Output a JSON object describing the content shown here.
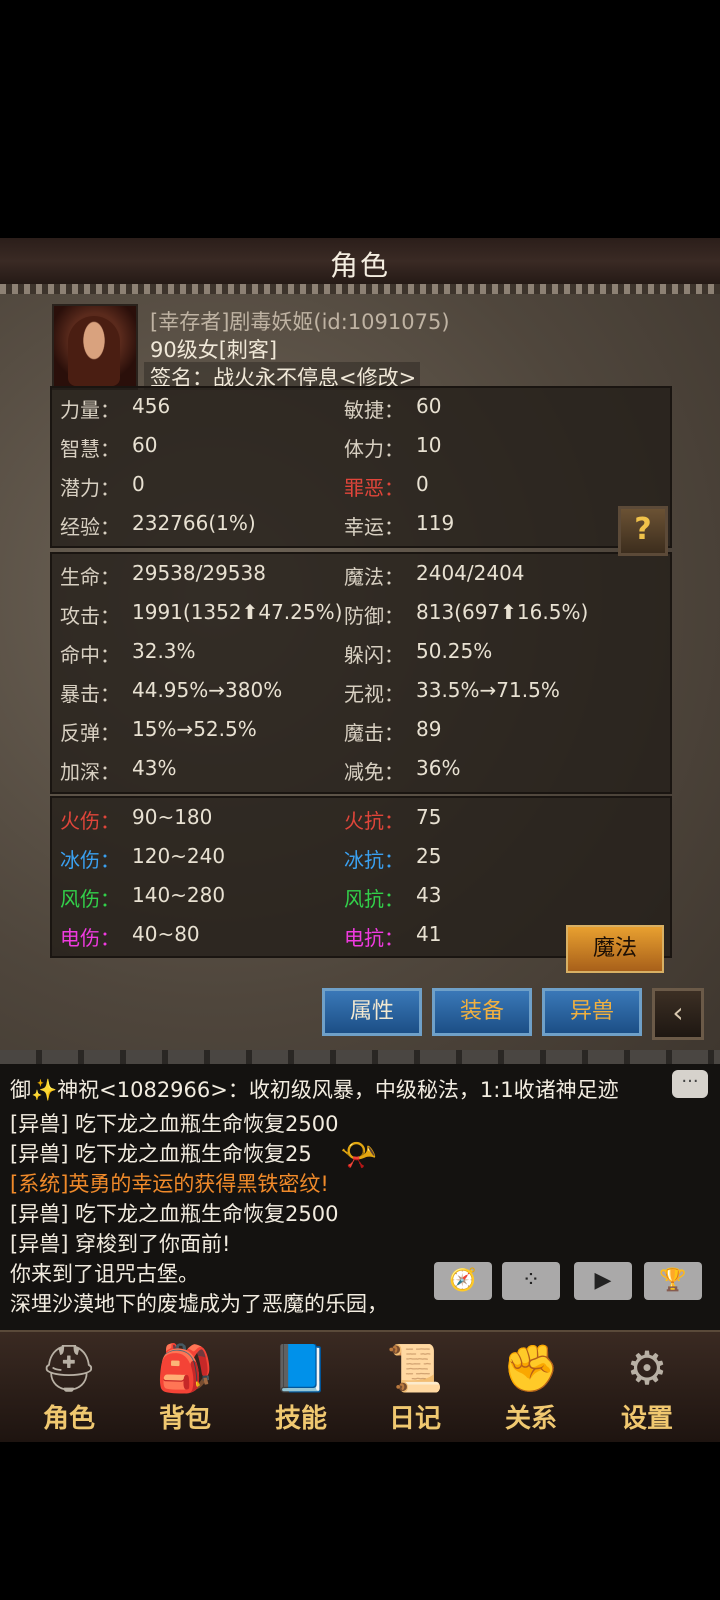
{
  "title": "角色",
  "character": {
    "name": "[幸存者]剧毒妖姬(id:1091075)",
    "level_class": "90级女[刺客]",
    "signature": "签名：战火永不停息<修改>"
  },
  "basic_stats": [
    {
      "label": "力量：",
      "value": "456"
    },
    {
      "label": "敏捷：",
      "value": "60"
    },
    {
      "label": "智慧：",
      "value": "60"
    },
    {
      "label": "体力：",
      "value": "10"
    },
    {
      "label": "潜力：",
      "value": "0"
    },
    {
      "label": "罪恶：",
      "value": "0",
      "color": "#e0453a"
    },
    {
      "label": "经验：",
      "value": "232766(1%)"
    },
    {
      "label": "幸运：",
      "value": "119"
    }
  ],
  "combat_stats": [
    {
      "label": "生命：",
      "value": "29538/29538"
    },
    {
      "label": "魔法：",
      "value": "2404/2404"
    },
    {
      "label": "攻击：",
      "value": "1991(1352⬆47.25%)"
    },
    {
      "label": "防御：",
      "value": "813(697⬆16.5%)"
    },
    {
      "label": "命中：",
      "value": "32.3%"
    },
    {
      "label": "躲闪：",
      "value": "50.25%"
    },
    {
      "label": "暴击：",
      "value": "44.95%→380%"
    },
    {
      "label": "无视：",
      "value": "33.5%→71.5%"
    },
    {
      "label": "反弹：",
      "value": "15%→52.5%"
    },
    {
      "label": "魔击：",
      "value": "89"
    },
    {
      "label": "加深：",
      "value": "43%"
    },
    {
      "label": "减免：",
      "value": "36%"
    }
  ],
  "element_stats": [
    {
      "label": "火伤：",
      "value": "90~180",
      "color": "#e0453a"
    },
    {
      "label": "火抗：",
      "value": "75",
      "color": "#e0453a"
    },
    {
      "label": "冰伤：",
      "value": "120~240",
      "color": "#3aa0f0"
    },
    {
      "label": "冰抗：",
      "value": "25",
      "color": "#3aa0f0"
    },
    {
      "label": "风伤：",
      "value": "140~280",
      "color": "#32d04a"
    },
    {
      "label": "风抗：",
      "value": "43",
      "color": "#32d04a"
    },
    {
      "label": "电伤：",
      "value": "40~80",
      "color": "#f03ae0"
    },
    {
      "label": "电抗：",
      "value": "41",
      "color": "#f03ae0"
    }
  ],
  "buttons": {
    "help": "?",
    "magic": "魔法",
    "tab_attributes": "属性",
    "tab_equipment": "装备",
    "tab_beast": "异兽",
    "back": "‹"
  },
  "chat": [
    {
      "text": "御✨神祝<1082966>：收初级风暴，中级秘法，1:1收诸神足迹",
      "type": "normal"
    },
    {
      "text": "[异兽] 吃下龙之血瓶生命恢复2500",
      "type": "normal"
    },
    {
      "text": "[异兽] 吃下龙之血瓶生命恢复25",
      "type": "normal"
    },
    {
      "text": "[系统]英勇的幸运的获得黑铁密纹!",
      "type": "sys"
    },
    {
      "text": "[异兽] 吃下龙之血瓶生命恢复2500",
      "type": "normal"
    },
    {
      "text": "[异兽] 穿梭到了你面前!",
      "type": "normal"
    },
    {
      "text": "你来到了诅咒古堡。",
      "type": "normal"
    },
    {
      "text": "深埋沙漠地下的废墟成为了恶魔的乐园，",
      "type": "normal"
    }
  ],
  "nav": [
    {
      "label": "角色",
      "icon": "helmet-icon"
    },
    {
      "label": "背包",
      "icon": "backpack-icon"
    },
    {
      "label": "技能",
      "icon": "skillbook-icon"
    },
    {
      "label": "日记",
      "icon": "scroll-icon"
    },
    {
      "label": "关系",
      "icon": "gauntlet-icon"
    },
    {
      "label": "设置",
      "icon": "gear-icon"
    }
  ]
}
